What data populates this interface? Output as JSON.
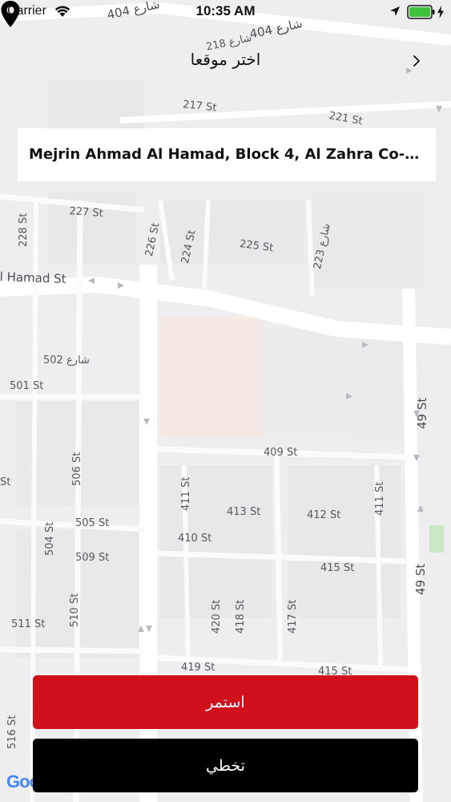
{
  "status_bar": {
    "carrier": "Carrier",
    "time": "10:35 AM"
  },
  "nav": {
    "title": "اختر موقعا",
    "back_icon": "chevron-right-icon"
  },
  "address": {
    "text": "Mejrin Ahmad Al Hamad, Block 4, Al Zahra Co-op,..."
  },
  "buttons": {
    "continue_label": "استمر",
    "skip_label": "تخطي"
  },
  "colors": {
    "continue_button": "#d0111b",
    "skip_button": "#000000",
    "map_background": "#f0f0f1"
  },
  "map": {
    "streets": [
      "404 شارع",
      "شارع 404",
      "218 شارع",
      "217 St",
      "221 St",
      "227 St",
      "228 St",
      "226 St",
      "224 St",
      "225 St",
      "223 شارع",
      "l Hamad St",
      "502 شارع",
      "501 St",
      "409 St",
      "49 St",
      "506 St",
      "St",
      "411 St",
      "413 St",
      "412 St",
      "411 St",
      "505 St",
      "410 St",
      "504 St",
      "509 St",
      "415 St",
      "49 St",
      "510 St",
      "511 St",
      "420 St",
      "418 St",
      "417 St",
      "419 St",
      "415 St",
      "516 St"
    ],
    "logo": "Google"
  }
}
